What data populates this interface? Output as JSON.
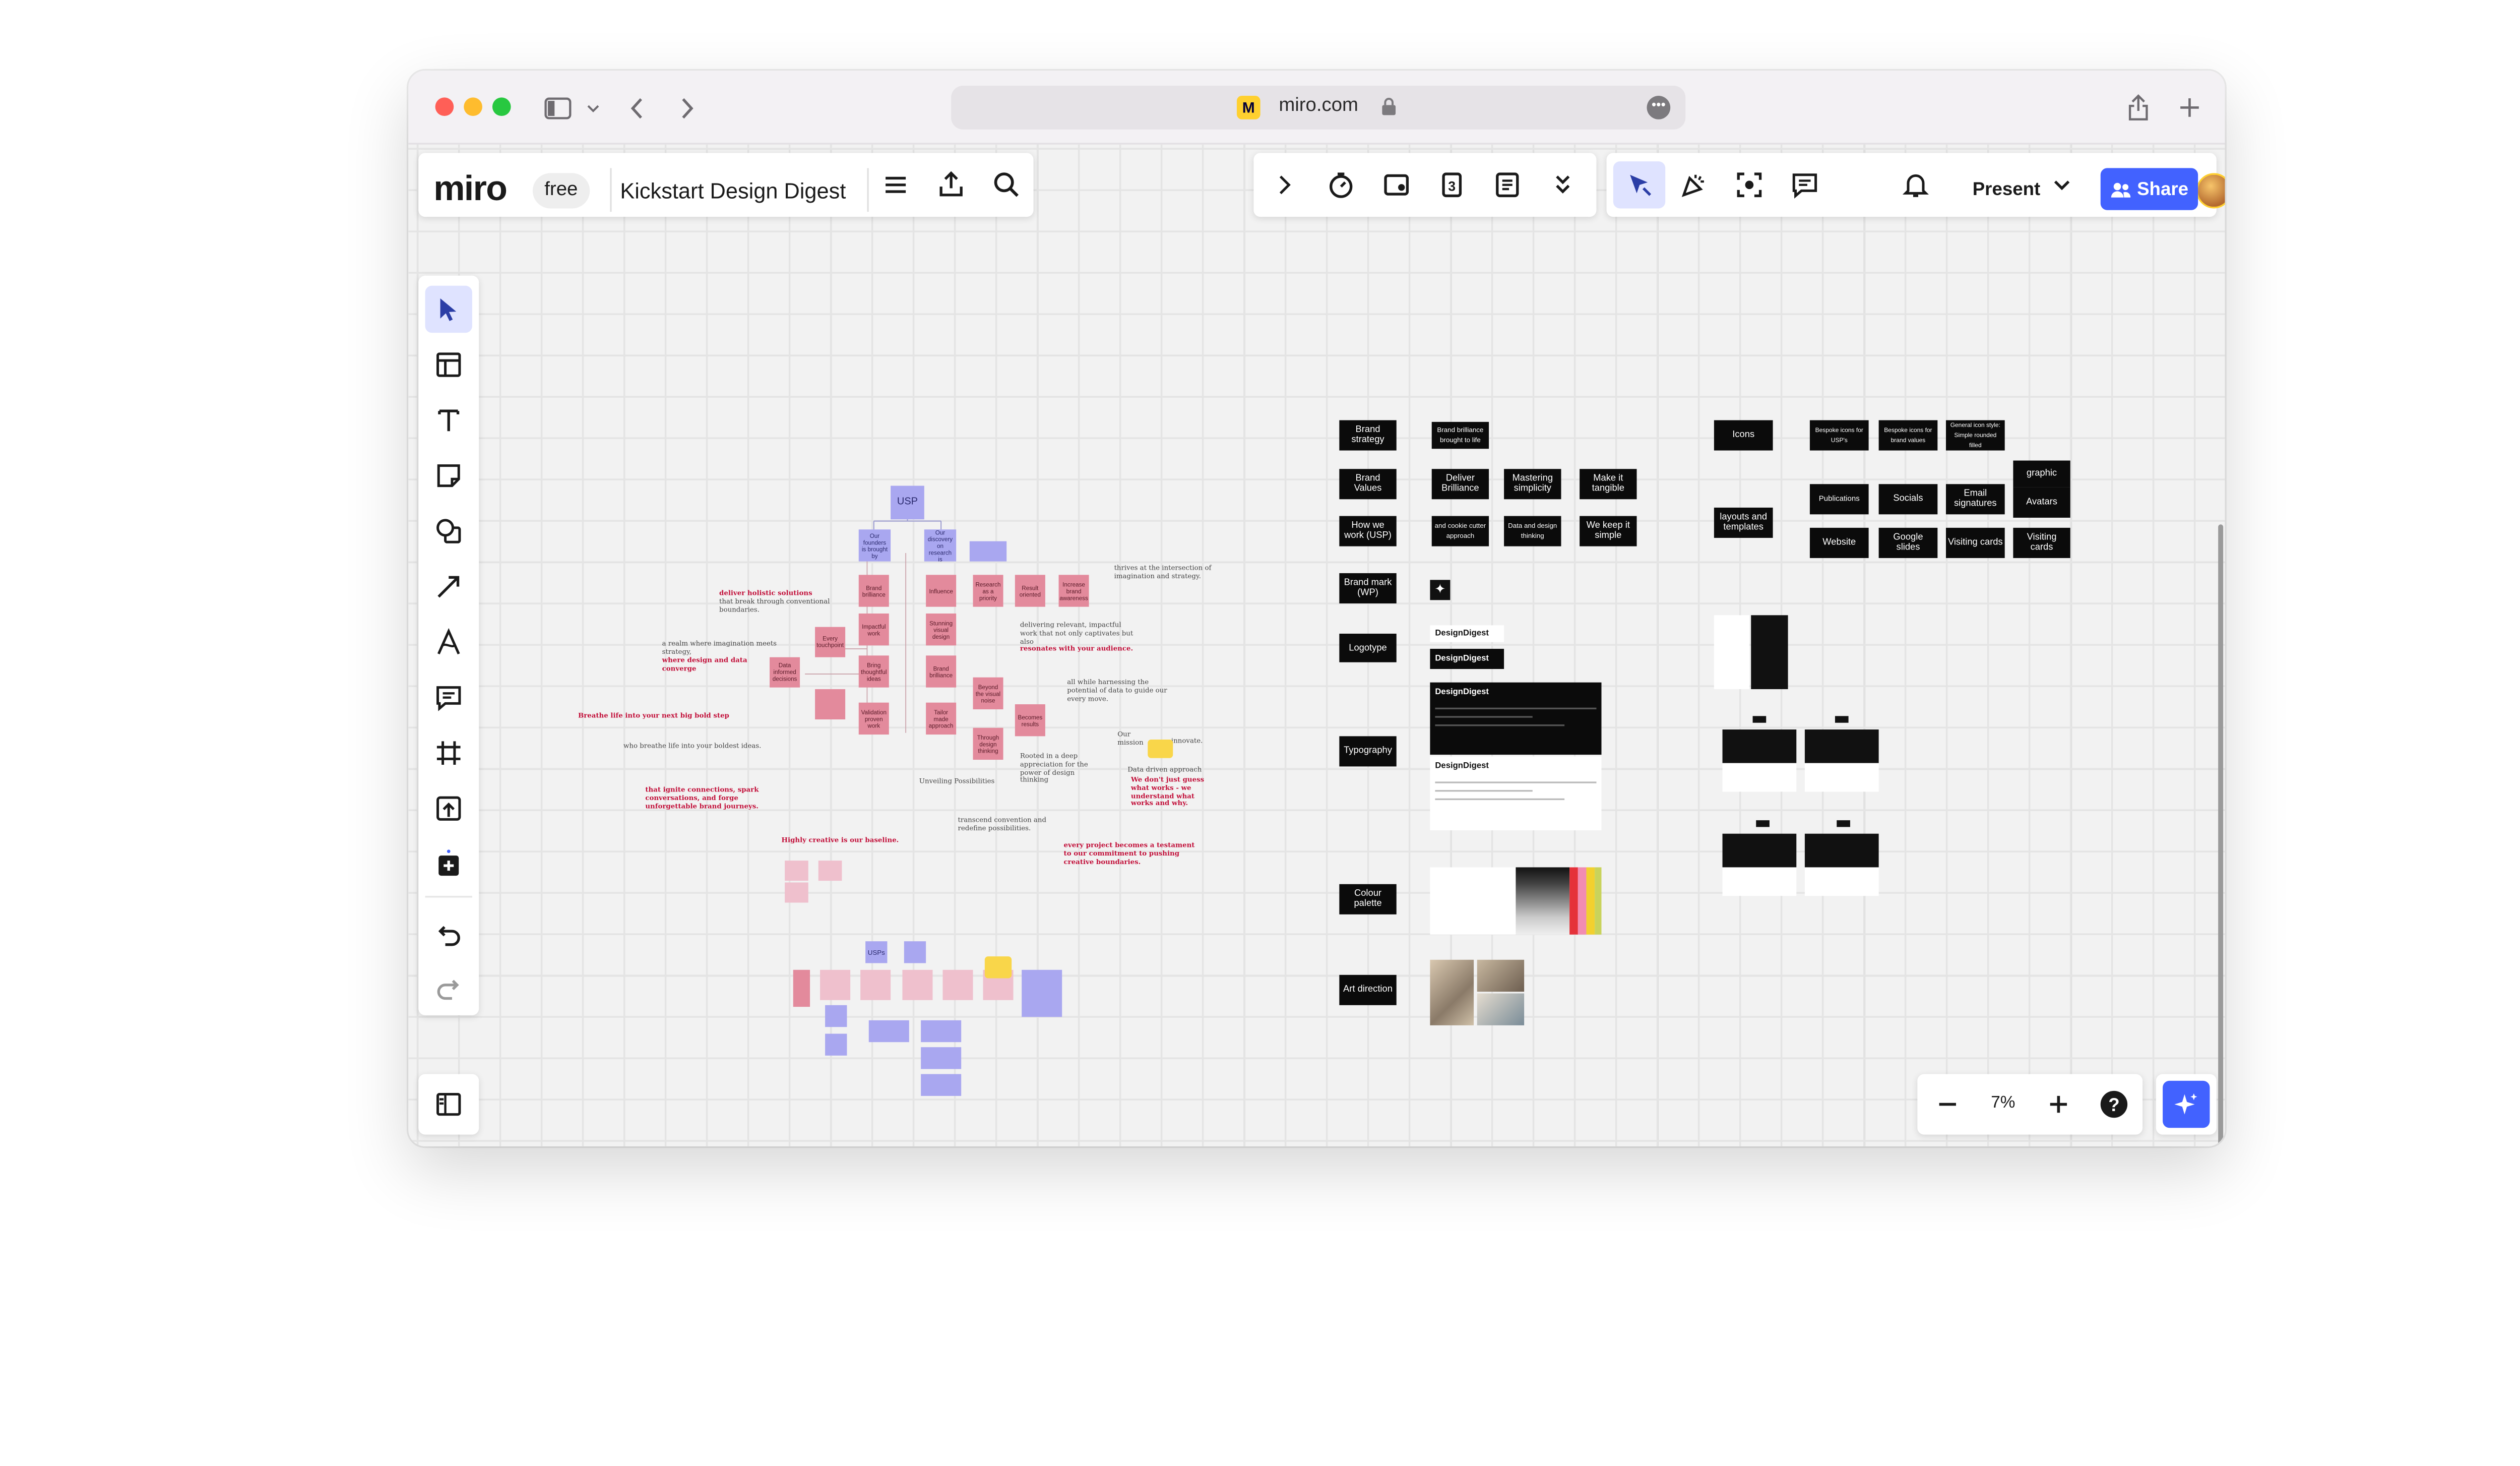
{
  "browser": {
    "url": "miro.com",
    "favicon_letter": "M"
  },
  "top_bar": {
    "logo": "miro",
    "plan_badge": "free",
    "board_title": "Kickstart Design Digest"
  },
  "toolbar": {
    "present_label": "Present",
    "share_label": "Share"
  },
  "zoom": {
    "level": "7%"
  },
  "board": {
    "brand_strategy": [
      "Brand strategy",
      "Brand Values",
      "How we work (USP)",
      "Brand mark (WP)",
      "Logotype",
      "Typography",
      "Colour palette",
      "Art direction"
    ],
    "brand_values": [
      "Brand brilliance brought to life",
      "Deliver Brilliance",
      "Mastering simplicity",
      "Make it tangible",
      "and cookie cutter approach",
      "Data and design thinking",
      "We keep it simple"
    ],
    "design_digest": [
      "DesignDigest",
      "DesignDigest",
      "DesignDigest",
      "DesignDigest"
    ],
    "assets": [
      "Icons",
      "Bespoke icons for USP's",
      "Bespoke icons for brand values",
      "General icon style: Simple rounded filled",
      "graphic",
      "Publications",
      "Socials",
      "Email signatures",
      "Avatars",
      "layouts and templates",
      "Website",
      "Google slides",
      "Visiting cards",
      "Visiting cards"
    ],
    "usp": {
      "root": "USP",
      "level1": [
        "Our founders is brought by",
        "Our discovery on research is",
        ""
      ],
      "pink_cards": [
        "Brand brilliance",
        "Impactful work",
        "Bring thoughtful ideas",
        "Validation proven work",
        "Influence",
        "Stunning visual design",
        "Brand brilliance",
        "Tailor made approach",
        "Research as a priority",
        "Beyond the visual noise",
        "Through design thinking",
        "Result oriented",
        "Becomes results",
        "Increase brand awareness",
        "Every touchpoint",
        "Data informed decisions"
      ],
      "usps_label": "USPs"
    },
    "notes": {
      "red": [
        "deliver holistic solutions",
        "where design and data converge",
        "Breathe life into your next big bold step",
        "that ignite connections, spark conversations, and forge unforgettable brand journeys.",
        "Highly creative is our baseline.",
        "resonates with your audience.",
        "We don't just guess what works - we understand what works and why.",
        "every project becomes a testament to our commitment to pushing creative boundaries."
      ],
      "gray": [
        "that break through conventional boundaries.",
        "a realm where imagination meets strategy,",
        "who breathe life into your boldest ideas.",
        "thrives at the intersection of imagination and strategy.",
        "delivering relevant, impactful work that not only captivates but also",
        "all while harnessing the potential of data to guide our every move.",
        "Rooted in a deep appreciation for the power of design thinking",
        "Unveiling Possibilities",
        "Data driven approach",
        "Our mission",
        "innovate.",
        "transcend convention and redefine possibilities."
      ]
    }
  },
  "colors": {
    "accent": "#4262ff",
    "miro_yellow": "#ffd02f",
    "pink_sticky": "#e38a9c",
    "blue_sticky": "#a9a7f0",
    "red_text": "#c2103a"
  },
  "icons": [
    "sidebar-toggle-icon",
    "chevron-down-icon",
    "back-icon",
    "forward-icon",
    "lock-icon",
    "more-icon",
    "share-icon",
    "new-tab-icon",
    "menu-icon",
    "export-icon",
    "search-icon",
    "expand-icon",
    "timer-icon",
    "card-icon",
    "voting-icon",
    "notes-icon",
    "more-tools-icon",
    "cursor-icon",
    "reaction-icon",
    "focus-icon",
    "comment-icon",
    "bell-icon",
    "select-icon",
    "templates-icon",
    "text-icon",
    "sticky-note-icon",
    "shapes-icon",
    "connector-icon",
    "pen-icon",
    "comment-tool-icon",
    "frame-icon",
    "upload-icon",
    "add-icon",
    "undo-icon",
    "redo-icon",
    "panel-icon",
    "zoom-out-icon",
    "zoom-in-icon",
    "help-icon",
    "ai-icon"
  ]
}
